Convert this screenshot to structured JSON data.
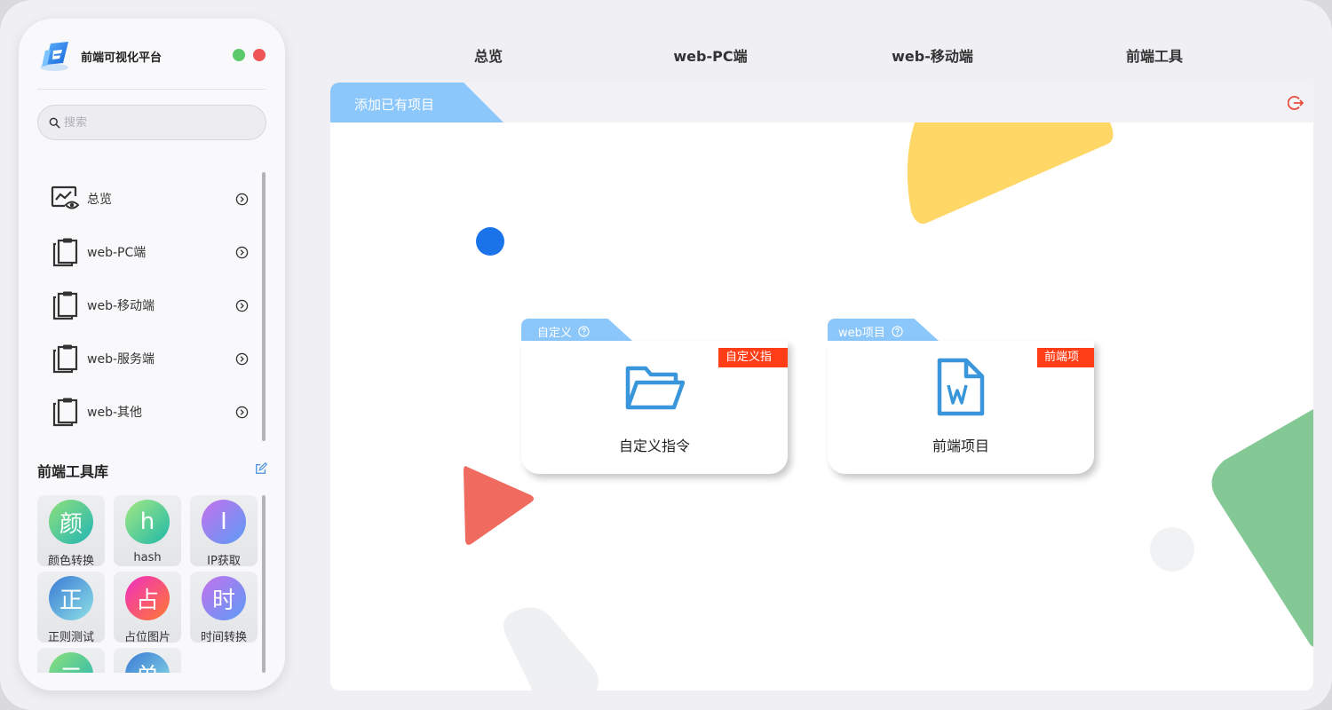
{
  "brand": {
    "name": "前端可视化平台"
  },
  "colors": {
    "accent": "#8cc7fb",
    "badge": "#ff3d17",
    "icon_blue": "#3a96db",
    "dot_green": "#5cc96b",
    "dot_red": "#ef5555"
  },
  "search": {
    "placeholder": "搜索",
    "value": ""
  },
  "nav": {
    "items": [
      {
        "label": "总览",
        "icon": "dashboard-eye-icon"
      },
      {
        "label": "web-PC端",
        "icon": "clipboard-icon"
      },
      {
        "label": "web-移动端",
        "icon": "clipboard-icon"
      },
      {
        "label": "web-服务端",
        "icon": "clipboard-icon"
      },
      {
        "label": "web-其他",
        "icon": "clipboard-icon"
      }
    ]
  },
  "toolbox": {
    "title": "前端工具库",
    "tools": [
      {
        "glyph": "颜",
        "label": "颜色转换"
      },
      {
        "glyph": "h",
        "label": "hash"
      },
      {
        "glyph": "I",
        "label": "IP获取"
      },
      {
        "glyph": "正",
        "label": "正则测试"
      },
      {
        "glyph": "占",
        "label": "占位图片"
      },
      {
        "glyph": "时",
        "label": "时间转换"
      },
      {
        "glyph": "二",
        "label": ""
      },
      {
        "glyph": "单",
        "label": ""
      }
    ]
  },
  "top_tabs": [
    "总览",
    "web-PC端",
    "web-移动端",
    "前端工具"
  ],
  "panel": {
    "tab_label": "添加已有项目"
  },
  "cards": [
    {
      "tab": "自定义",
      "badge": "自定义指令",
      "title": "自定义指令",
      "icon": "folder-open-icon"
    },
    {
      "tab": "web项目",
      "badge": "前端项目",
      "title": "前端项目",
      "icon": "word-document-icon"
    }
  ]
}
